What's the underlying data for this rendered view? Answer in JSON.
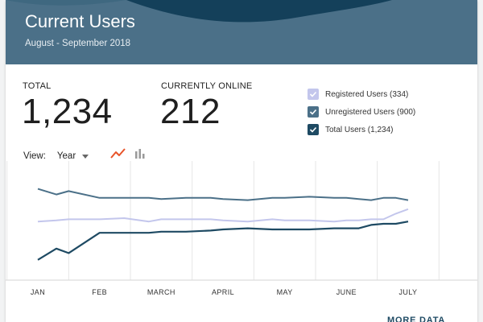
{
  "header": {
    "title": "Current Users",
    "subtitle": "August - September 2018"
  },
  "stats": {
    "total_label": "TOTAL",
    "total_value": "1,234",
    "online_label": "CURRENTLY ONLINE",
    "online_value": "212"
  },
  "legend": [
    {
      "label": "Registered Users (334)",
      "color": "#c3c6ec",
      "checked": true
    },
    {
      "label": "Unregistered Users (900)",
      "color": "#4b7088",
      "checked": true
    },
    {
      "label": "Total Users (1,234)",
      "color": "#1e4a63",
      "checked": true
    }
  ],
  "controls": {
    "view_label": "View:",
    "view_value": "Year",
    "line_icon": "line-chart-icon",
    "bar_icon": "bar-chart-icon",
    "active_color": "#e8542a"
  },
  "footer": {
    "more_label": "MORE DATA"
  },
  "chart_data": {
    "type": "line",
    "categories": [
      "JAN",
      "FEB",
      "MARCH",
      "APRIL",
      "MAY",
      "JUNE",
      "JULY"
    ],
    "x": [
      0,
      0.3,
      0.5,
      1.0,
      1.4,
      1.8,
      2.0,
      2.4,
      2.8,
      3.0,
      3.4,
      3.8,
      4.0,
      4.4,
      4.8,
      5.0,
      5.2,
      5.4,
      5.6,
      5.8,
      6.0
    ],
    "series": [
      {
        "name": "Unregistered Users (900)",
        "color": "#4b7088",
        "values": [
          81,
          76,
          79,
          73,
          73,
          73,
          72,
          73,
          73,
          72,
          71,
          73,
          73,
          74,
          73,
          73,
          72,
          71,
          73,
          73,
          71
        ]
      },
      {
        "name": "Registered Users (334)",
        "color": "#c3c6ec",
        "values": [
          52,
          53,
          54,
          54,
          55,
          52,
          54,
          54,
          54,
          53,
          52,
          54,
          53,
          53,
          52,
          53,
          53,
          54,
          54,
          59,
          63
        ]
      },
      {
        "name": "Total Users (1,234)",
        "color": "#1e4a63",
        "values": [
          18,
          28,
          24,
          42,
          42,
          42,
          43,
          43,
          44,
          45,
          46,
          45,
          45,
          45,
          46,
          46,
          46,
          49,
          50,
          50,
          52
        ]
      }
    ],
    "grid": "vertical",
    "ylim": [
      0,
      100
    ]
  }
}
